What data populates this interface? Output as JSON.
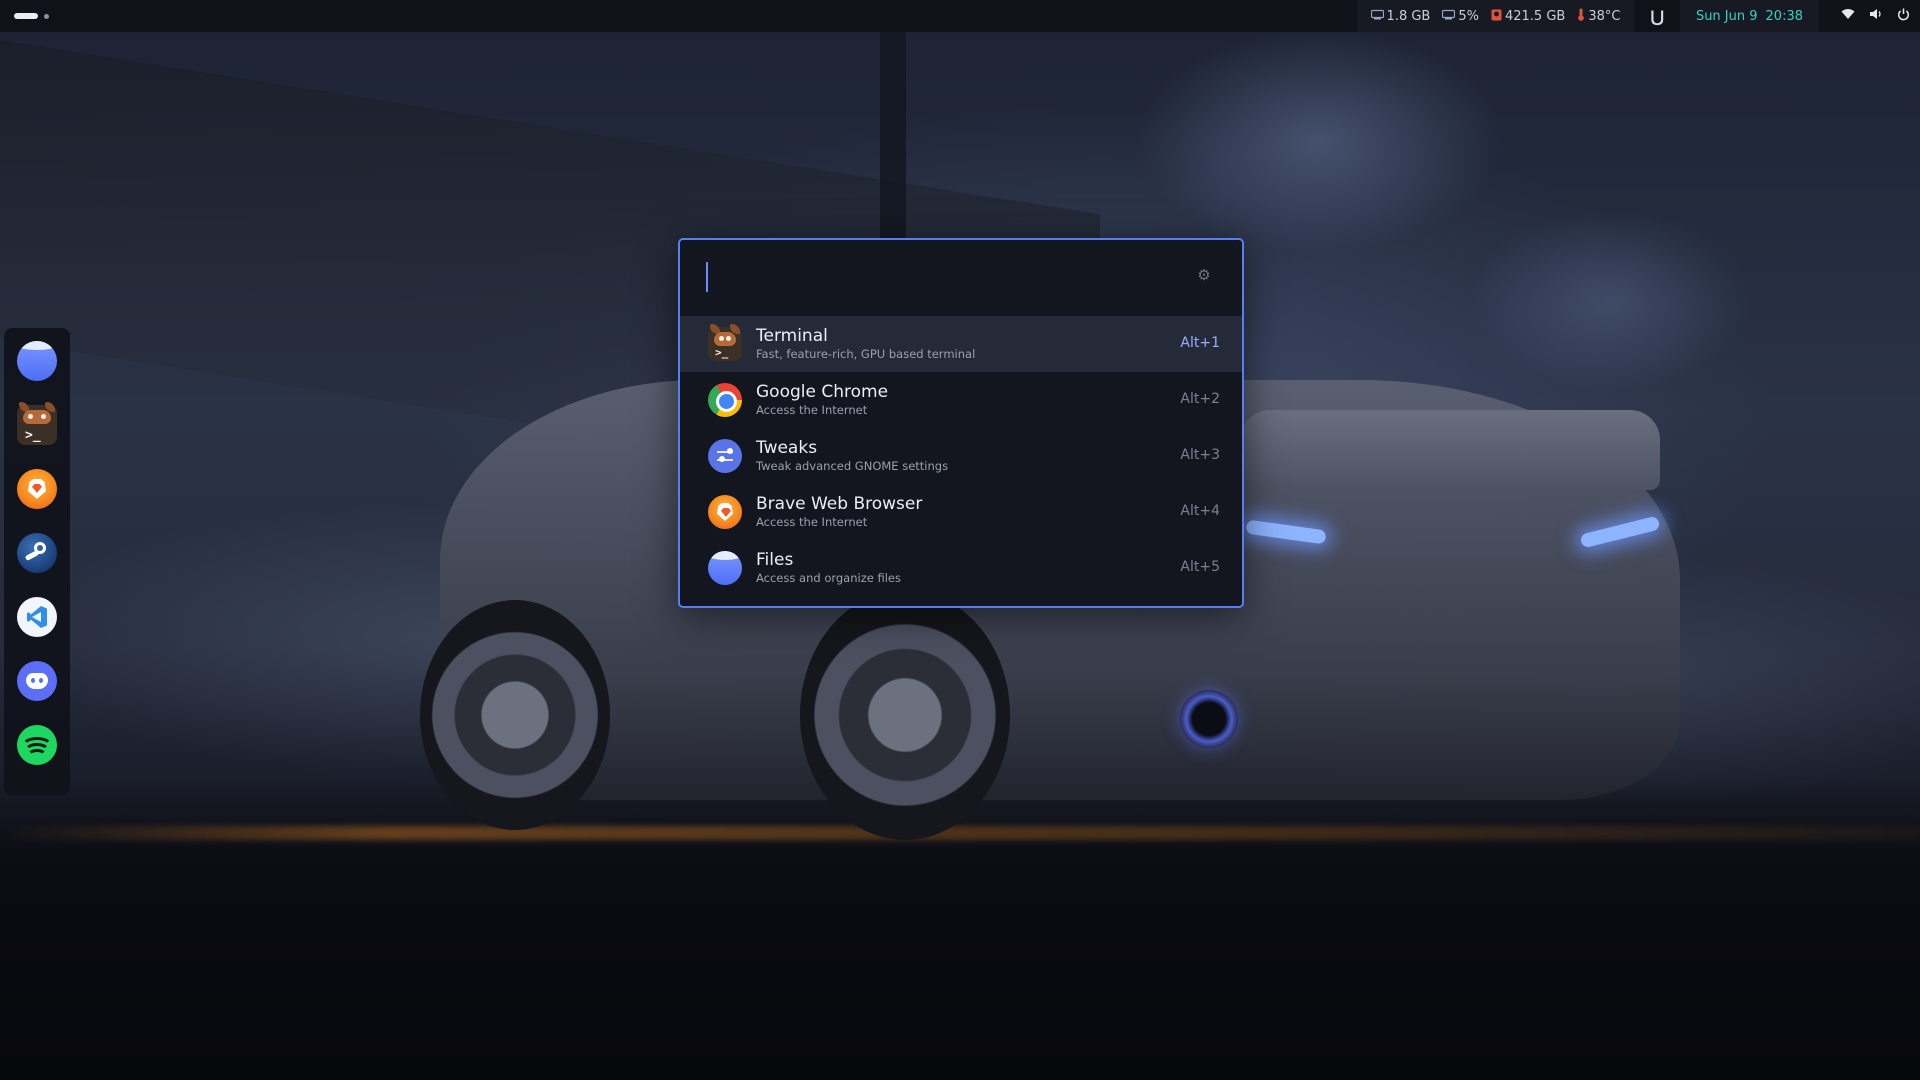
{
  "topbar": {
    "workspaces": [
      "active",
      "inactive"
    ],
    "stats": [
      {
        "icon": "memory-icon",
        "value": "1.8 GB"
      },
      {
        "icon": "cpu-icon",
        "value": "5%"
      },
      {
        "icon": "disk-icon",
        "value": "421.5 GB"
      },
      {
        "icon": "thermometer-icon",
        "value": "38°C"
      }
    ],
    "extension_icon": "arch-u-icon",
    "clock": {
      "date": "Sun Jun 9",
      "time": "20:38"
    },
    "tray": [
      "wifi-icon",
      "volume-icon",
      "power-icon"
    ],
    "accent_clock": "#3ad1c5"
  },
  "dock": {
    "items": [
      {
        "name": "files",
        "icon": "files-icon"
      },
      {
        "name": "terminal",
        "icon": "kitty-icon"
      },
      {
        "name": "brave",
        "icon": "brave-icon"
      },
      {
        "name": "steam",
        "icon": "steam-icon"
      },
      {
        "name": "vscode",
        "icon": "vscode-icon"
      },
      {
        "name": "discord",
        "icon": "discord-icon"
      },
      {
        "name": "spotify",
        "icon": "spotify-icon"
      }
    ]
  },
  "launcher": {
    "search": {
      "value": "",
      "placeholder": ""
    },
    "accent": "#5a7ef0",
    "results": [
      {
        "title": "Terminal",
        "subtitle": "Fast, feature-rich, GPU based terminal",
        "shortcut": "Alt+1",
        "icon": "kitty-icon",
        "selected": true
      },
      {
        "title": "Google Chrome",
        "subtitle": "Access the Internet",
        "shortcut": "Alt+2",
        "icon": "chrome-icon",
        "selected": false
      },
      {
        "title": "Tweaks",
        "subtitle": "Tweak advanced GNOME settings",
        "shortcut": "Alt+3",
        "icon": "tweaks-icon",
        "selected": false
      },
      {
        "title": "Brave Web Browser",
        "subtitle": "Access the Internet",
        "shortcut": "Alt+4",
        "icon": "brave-icon",
        "selected": false
      },
      {
        "title": "Files",
        "subtitle": "Access and organize files",
        "shortcut": "Alt+5",
        "icon": "files-icon",
        "selected": false
      }
    ]
  }
}
